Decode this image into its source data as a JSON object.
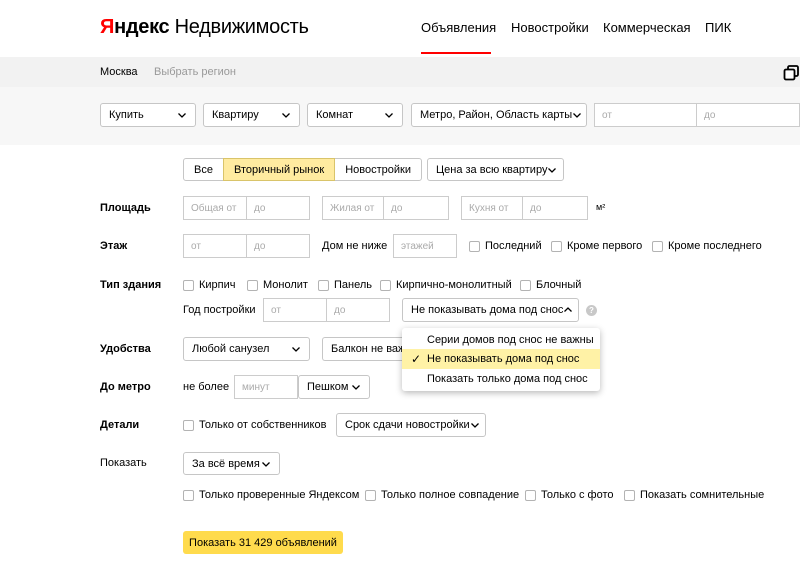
{
  "header": {
    "logo_ya": "Я",
    "logo_ndex": "ндекс",
    "logo_service": "Недвижимость",
    "nav": [
      "Объявления",
      "Новостройки",
      "Коммерческая",
      "ПИК"
    ]
  },
  "region": {
    "city": "Москва",
    "choose": "Выбрать регион"
  },
  "top_filters": {
    "deal": "Купить",
    "object": "Квартиру",
    "rooms": "Комнат",
    "location": "Метро, Район, Область карты",
    "price_from": "от",
    "price_to": "до"
  },
  "market_segments": [
    "Все",
    "Вторичный рынок",
    "Новостройки"
  ],
  "price_type": "Цена за всю квартиру",
  "area": {
    "label": "Площадь",
    "total_from": "Общая от",
    "total_to": "до",
    "living_from": "Жилая от",
    "living_to": "до",
    "kitchen_from": "Кухня от",
    "kitchen_to": "до",
    "unit": "м²"
  },
  "floor": {
    "label": "Этаж",
    "from": "от",
    "to": "до",
    "house_min_label": "Дом не ниже",
    "house_min_placeholder": "этажей",
    "last": "Последний",
    "not_first": "Кроме первого",
    "not_last": "Кроме последнего"
  },
  "building": {
    "label": "Тип здания",
    "types": [
      "Кирпич",
      "Монолит",
      "Панель",
      "Кирпично-монолитный",
      "Блочный"
    ],
    "year_label": "Год постройки",
    "year_from": "от",
    "year_to": "до",
    "demolition_select": "Не показывать дома под снос",
    "help": "?"
  },
  "demolition_dropdown": {
    "options": [
      "Серии домов под снос не важны",
      "Не показывать дома под снос",
      "Показать только дома под снос"
    ],
    "selected_index": 1,
    "check": "✓"
  },
  "amenities": {
    "label": "Удобства",
    "bathroom": "Любой санузел",
    "balcony": "Балкон не важен"
  },
  "metro": {
    "label": "До метро",
    "not_more": "не более",
    "minutes_placeholder": "минут",
    "mode": "Пешком"
  },
  "details": {
    "label": "Детали",
    "owners_only": "Только от собственников",
    "deadline": "Срок сдачи новостройки"
  },
  "show": {
    "label": "Показать",
    "period": "За всё время",
    "checkboxes": [
      "Только проверенные Яндексом",
      "Только полное совпадение",
      "Только с фото",
      "Показать сомнительные"
    ]
  },
  "submit_label": "Показать 31 429 объявлений",
  "colors": {
    "accent_red": "#ff0000",
    "yellow": "#ffdb4d",
    "segment_active": "#ffeba0",
    "selected_option": "#fff2a6"
  }
}
